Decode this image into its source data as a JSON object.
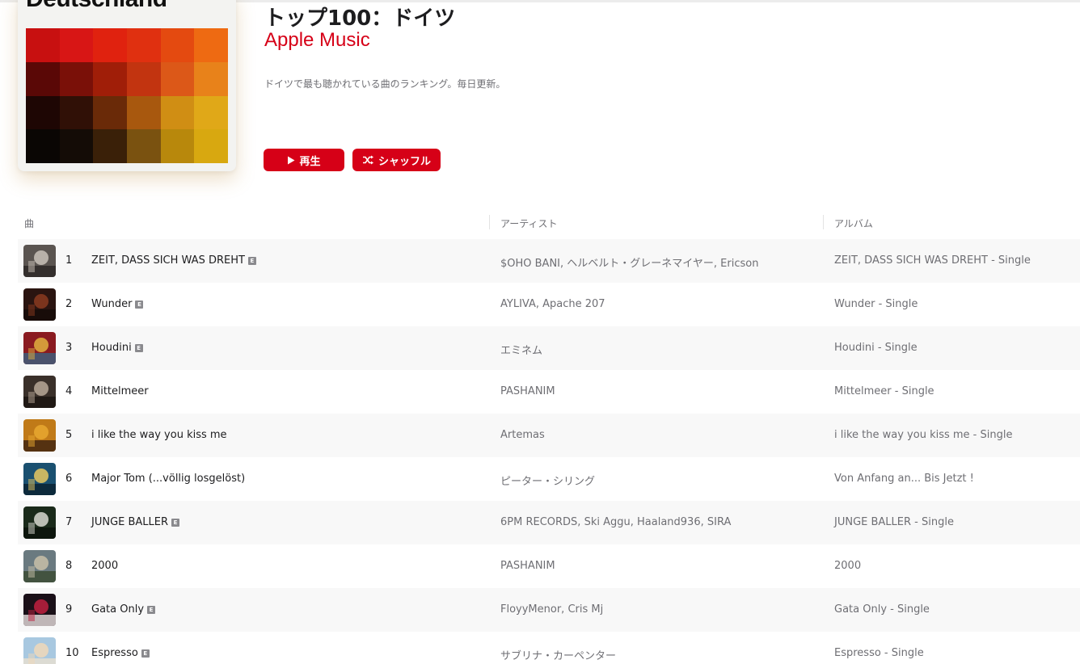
{
  "artwork": {
    "title": "Deutschland",
    "palette": [
      [
        "#c81010",
        "#d81615",
        "#e0220f",
        "#e03010",
        "#e44a10",
        "#ee6a12"
      ],
      [
        "#5a0806",
        "#7a1008",
        "#a01e08",
        "#c23410",
        "#dc5818",
        "#e8821a"
      ],
      [
        "#1e0604",
        "#301006",
        "#6a2a08",
        "#a8580e",
        "#d08e14",
        "#e0a818"
      ],
      [
        "#0a0604",
        "#140c06",
        "#3a2008",
        "#7a5210",
        "#b8880c",
        "#d8a810"
      ]
    ]
  },
  "header": {
    "title": "トップ100：ドイツ",
    "curator": "Apple Music",
    "description": "ドイツで最も聴かれている曲のランキング。毎日更新。"
  },
  "buttons": {
    "play_label": "再生",
    "shuffle_label": "シャッフル"
  },
  "columns": {
    "song": "曲",
    "artist": "アーティスト",
    "album": "アルバム"
  },
  "colors": {
    "accent": "#d60017"
  },
  "tracks": [
    {
      "rank": "1",
      "title": "ZEIT, DASS SICH WAS DREHT",
      "explicit": true,
      "artist": "$OHO BANI, ヘルベルト・グレーネマイヤー, Ericson",
      "album": "ZEIT, DASS SICH WAS DREHT - Single",
      "thumb": [
        "#5a5450",
        "#c9c2b8",
        "#2a2624"
      ]
    },
    {
      "rank": "2",
      "title": "Wunder",
      "explicit": true,
      "artist": "AYLIVA, Apache 207",
      "album": "Wunder - Single",
      "thumb": [
        "#2a1410",
        "#8a3a20",
        "#140a08"
      ]
    },
    {
      "rank": "3",
      "title": "Houdini",
      "explicit": true,
      "artist": "エミネム",
      "album": "Houdini - Single",
      "thumb": [
        "#8a1a20",
        "#e0b040",
        "#3a6080"
      ]
    },
    {
      "rank": "4",
      "title": "Mittelmeer",
      "explicit": false,
      "artist": "PASHANIM",
      "album": "Mittelmeer - Single",
      "thumb": [
        "#3a302a",
        "#b8a898",
        "#1a1410"
      ]
    },
    {
      "rank": "5",
      "title": "i like the way you kiss me",
      "explicit": false,
      "artist": "Artemas",
      "album": "i like the way you kiss me - Single",
      "thumb": [
        "#c07a18",
        "#e8a830",
        "#3a2010"
      ]
    },
    {
      "rank": "6",
      "title": "Major Tom (...völlig losgelöst)",
      "explicit": false,
      "artist": "ピーター・シリング",
      "album": "Von Anfang an... Bis Jetzt !",
      "thumb": [
        "#1a5070",
        "#e8c860",
        "#0a2030"
      ]
    },
    {
      "rank": "7",
      "title": "JUNGE BALLER",
      "explicit": true,
      "artist": "6PM RECORDS, Ski Aggu, Haaland936, SIRA",
      "album": "JUNGE BALLER - Single",
      "thumb": [
        "#1a2a1a",
        "#d8d8d0",
        "#0a120a"
      ]
    },
    {
      "rank": "8",
      "title": "2000",
      "explicit": false,
      "artist": "PASHANIM",
      "album": "2000",
      "thumb": [
        "#6a7a80",
        "#c8c0a8",
        "#3a4a30"
      ]
    },
    {
      "rank": "9",
      "title": "Gata Only",
      "explicit": true,
      "artist": "FloyyMenor, Cris Mj",
      "album": "Gata Only - Single",
      "thumb": [
        "#1a1018",
        "#c02040",
        "#e8e0e0"
      ]
    },
    {
      "rank": "10",
      "title": "Espresso",
      "explicit": true,
      "artist": "サブリナ・カーペンター",
      "album": "Espresso - Single",
      "thumb": [
        "#a8c8e0",
        "#f0d8b8",
        "#e8e0d0"
      ]
    }
  ]
}
